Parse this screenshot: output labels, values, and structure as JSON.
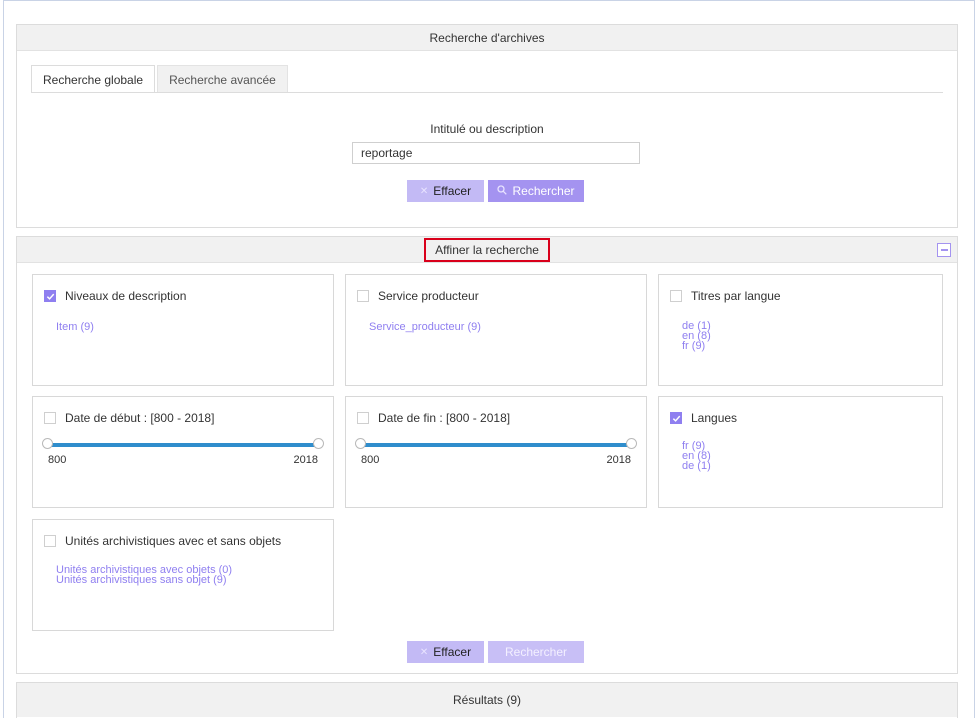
{
  "search_panel": {
    "title": "Recherche d'archives",
    "tabs": [
      {
        "label": "Recherche globale",
        "active": true
      },
      {
        "label": "Recherche avancée",
        "active": false
      }
    ],
    "field_label": "Intitulé ou description",
    "field_value": "reportage",
    "clear_label": "Effacer",
    "search_label": "Rechercher"
  },
  "refine_panel": {
    "title": "Affiner la recherche",
    "facets": {
      "levels": {
        "title": "Niveaux de description",
        "checked": true,
        "items": [
          "Item (9)"
        ]
      },
      "producer": {
        "title": "Service producteur",
        "checked": false,
        "items": [
          "Service_producteur (9)"
        ]
      },
      "titles_lang": {
        "title": "Titres par langue",
        "checked": false,
        "items": [
          "de (1)",
          "en (8)",
          "fr (9)"
        ]
      },
      "start_date": {
        "title": "Date de début : [800 - 2018]",
        "checked": false,
        "min": "800",
        "max": "2018"
      },
      "end_date": {
        "title": "Date de fin : [800 - 2018]",
        "checked": false,
        "min": "800",
        "max": "2018"
      },
      "languages": {
        "title": "Langues",
        "checked": true,
        "items": [
          "fr (9)",
          "en (8)",
          "de (1)"
        ]
      },
      "objects": {
        "title": "Unités archivistiques avec et sans objets",
        "checked": false,
        "items": [
          "Unités archivistiques avec objets (0)",
          "Unités archivistiques sans objet (9)"
        ]
      }
    },
    "clear_label": "Effacer",
    "search_label": "Rechercher"
  },
  "results_panel": {
    "title": "Résultats (9)"
  },
  "colors": {
    "accent": "#a493f0",
    "link": "#8f7ff0",
    "slider": "#2f8dcc",
    "highlight": "#d9001b"
  }
}
